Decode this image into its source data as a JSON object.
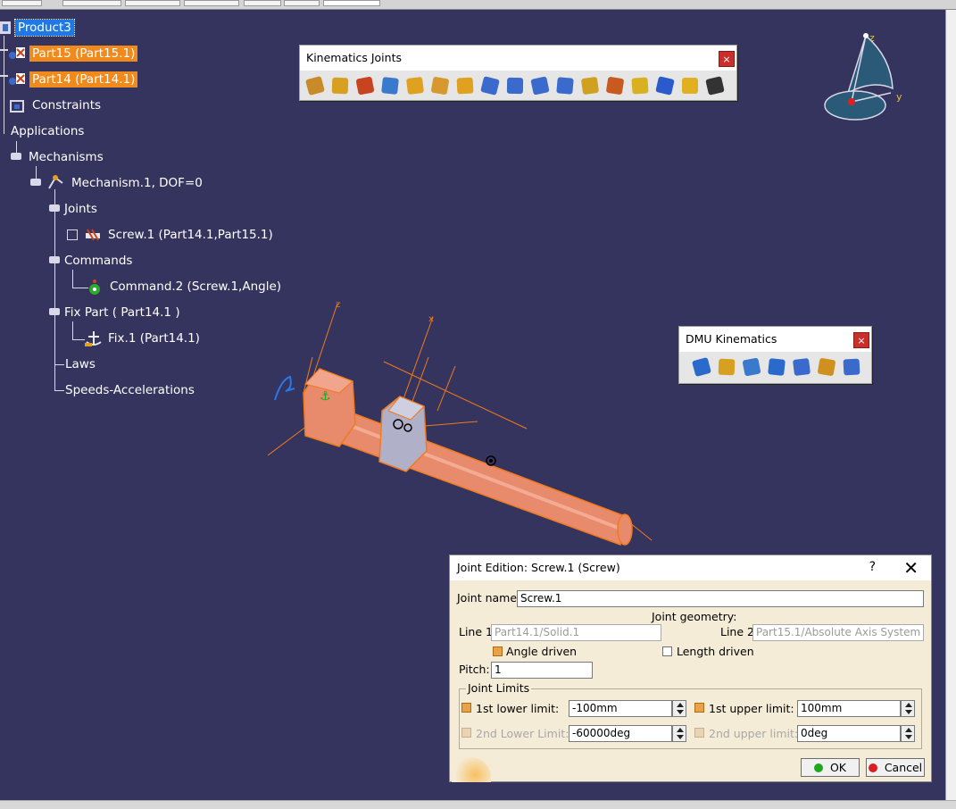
{
  "tree": {
    "root": "Product3",
    "part15": "Part15 (Part15.1)",
    "part14": "Part14 (Part14.1)",
    "constraints": "Constraints",
    "applications": "Applications",
    "mechanisms": "Mechanisms",
    "mechanism": "Mechanism.1, DOF=0",
    "joints": "Joints",
    "screw": "Screw.1 (Part14.1,Part15.1)",
    "commands": "Commands",
    "command": "Command.2 (Screw.1,Angle)",
    "fix_part": "Fix Part ( Part14.1 )",
    "fix": "Fix.1 (Part14.1)",
    "laws": "Laws",
    "speeds": "Speeds-Accelerations"
  },
  "kinematics_toolbar": {
    "title": "Kinematics Joints",
    "close": "×",
    "icons": [
      "revolute-joint",
      "prismatic-joint",
      "cylindrical-joint",
      "screw-joint",
      "spherical-joint",
      "planar-joint",
      "rigid-joint",
      "point-curve-joint",
      "slide-curve-joint",
      "roll-curve-joint",
      "point-surface-joint",
      "universal-joint",
      "cv-joint",
      "gear-joint",
      "rack-joint",
      "cable-joint",
      "axis-system-joint"
    ],
    "colors": [
      "#c98a2a",
      "#d8a020",
      "#c8431f",
      "#3a7acc",
      "#e0a020",
      "#d89830",
      "#e0a020",
      "#3a6acc",
      "#3a6acc",
      "#3a6acc",
      "#3a6acc",
      "#d0a020",
      "#c85a20",
      "#d8b020",
      "#2a5acc",
      "#e0b020",
      "#333333"
    ]
  },
  "dmu_toolbar": {
    "title": "DMU Kinematics",
    "close": "×",
    "icons": [
      "simulation",
      "fixed-part",
      "assembly-constraints",
      "speed-acceleration",
      "mechanism-analysis",
      "laws",
      "sensors"
    ],
    "colors": [
      "#2a6acc",
      "#d8a020",
      "#3a7acc",
      "#2a6acc",
      "#3a6acc",
      "#d09020",
      "#3a6acc"
    ]
  },
  "compass": {
    "z": "z",
    "y": "y"
  },
  "dialog": {
    "title": "Joint Edition: Screw.1 (Screw)",
    "help": "?",
    "close": "✕",
    "joint_name_label": "Joint name:",
    "joint_name": "Screw.1",
    "joint_geometry": "Joint geometry:",
    "line1_label": "Line 1:",
    "line1": "Part14.1/Solid.1",
    "line2_label": "Line 2:",
    "line2": "Part15.1/Absolute Axis System",
    "angle_driven": "Angle driven",
    "angle_driven_checked": true,
    "length_driven": "Length driven",
    "length_driven_checked": false,
    "pitch_label": "Pitch:",
    "pitch": "1",
    "limits_title": "Joint Limits",
    "first_lower_label": "1st lower limit:",
    "first_lower": "-100mm",
    "first_upper_label": "1st upper limit:",
    "first_upper": "100mm",
    "second_lower_label": "2nd Lower Limit:",
    "second_lower": "-60000deg",
    "second_upper_label": "2nd upper limit:",
    "second_upper": "0deg",
    "ok": "OK",
    "cancel": "Cancel"
  },
  "colors": {
    "background": "#34345e",
    "selected": "#1e78e6",
    "highlight": "#f08a1c",
    "part": "#e87a5a"
  }
}
